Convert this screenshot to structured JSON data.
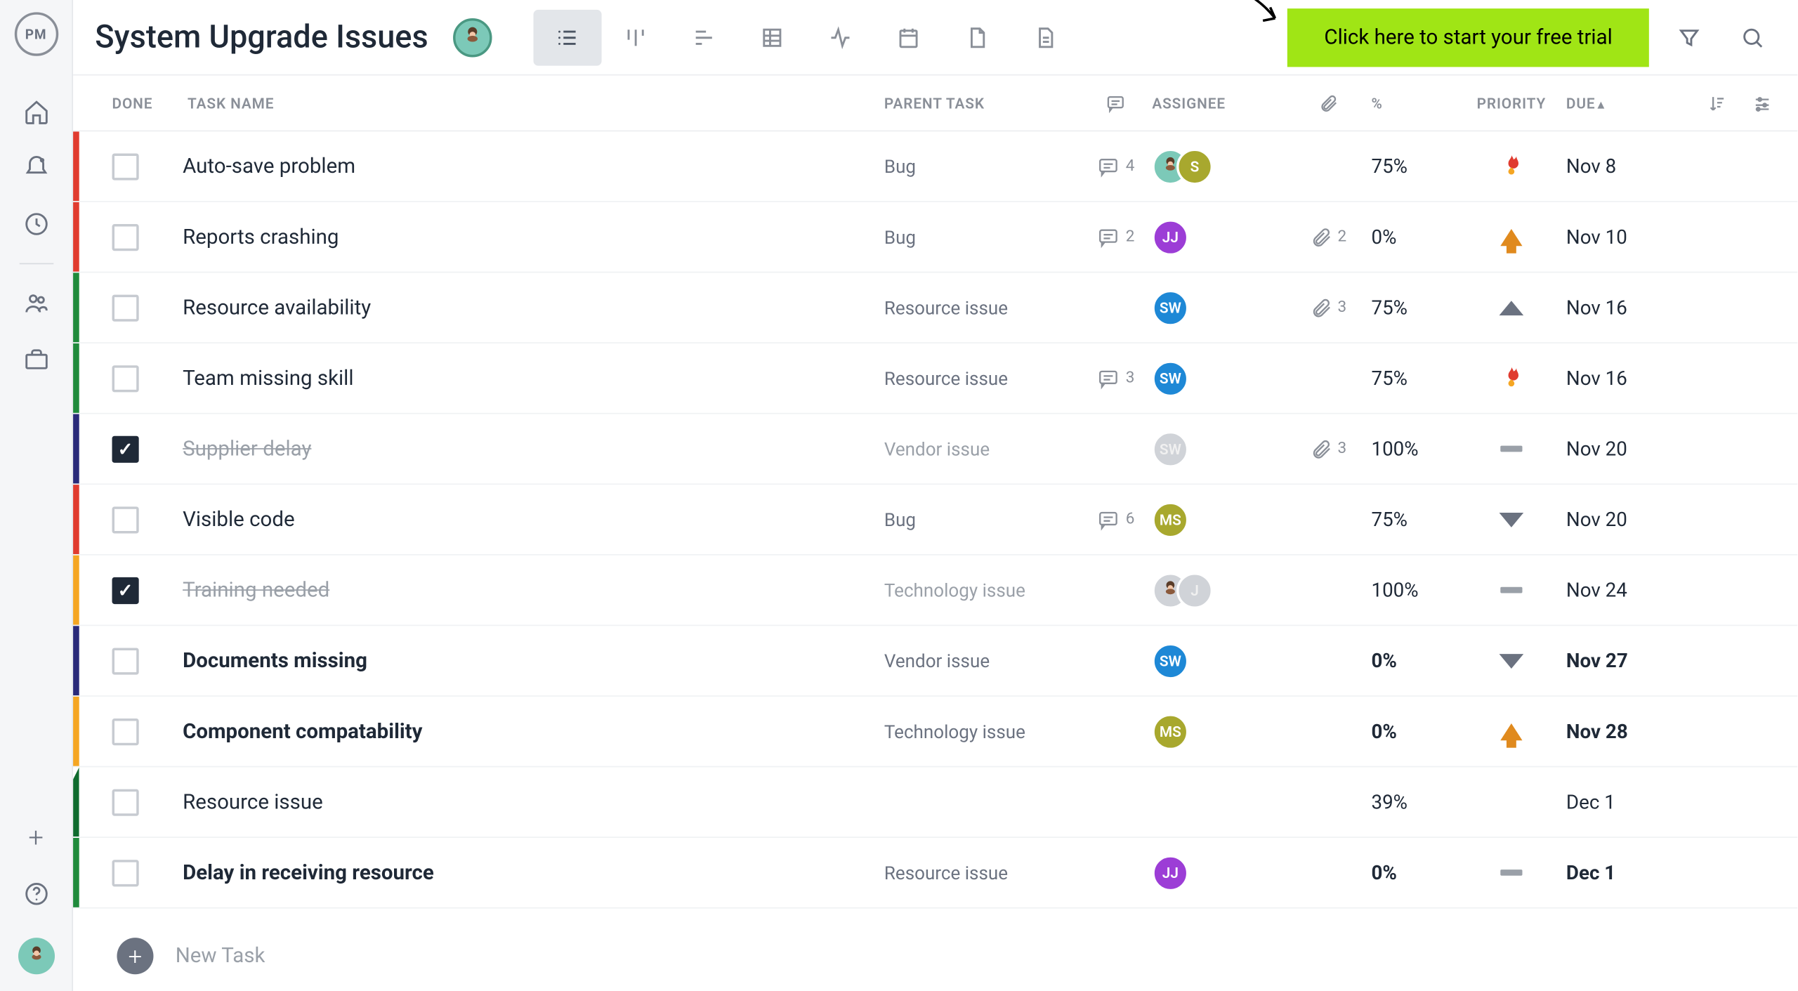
{
  "app": {
    "logo_text": "PM",
    "title": "System Upgrade Issues",
    "trial_cta": "Click here to start your free trial",
    "new_task_label": "New Task"
  },
  "columns": {
    "done": "DONE",
    "task_name": "TASK NAME",
    "parent_task": "PARENT TASK",
    "assignee": "ASSIGNEE",
    "percent": "%",
    "priority": "PRIORITY",
    "due": "DUE"
  },
  "stripe_colors": {
    "red": "#e03b2f",
    "green": "#1f8a3b",
    "navy": "#2a2a7a",
    "orange": "#f5a623",
    "dark_green": "#0f6b2e"
  },
  "tasks": [
    {
      "done": false,
      "bold": false,
      "stripe": "red",
      "name": "Auto-save problem",
      "parent": "Bug",
      "comments": 4,
      "attachments": null,
      "assignees": [
        {
          "type": "img"
        },
        {
          "type": "s",
          "label": "S"
        }
      ],
      "percent": "75%",
      "priority": "flame",
      "due": "Nov 8"
    },
    {
      "done": false,
      "bold": false,
      "stripe": "red",
      "name": "Reports crashing",
      "parent": "Bug",
      "comments": 2,
      "attachments": 2,
      "assignees": [
        {
          "type": "jj",
          "label": "JJ"
        }
      ],
      "percent": "0%",
      "priority": "up",
      "due": "Nov 10"
    },
    {
      "done": false,
      "bold": false,
      "stripe": "green",
      "name": "Resource availability",
      "parent": "Resource issue",
      "comments": null,
      "attachments": 3,
      "assignees": [
        {
          "type": "sw",
          "label": "SW"
        }
      ],
      "percent": "75%",
      "priority": "tri-up",
      "due": "Nov 16"
    },
    {
      "done": false,
      "bold": false,
      "stripe": "green",
      "name": "Team missing skill",
      "parent": "Resource issue",
      "comments": 3,
      "attachments": null,
      "assignees": [
        {
          "type": "sw",
          "label": "SW"
        }
      ],
      "percent": "75%",
      "priority": "flame",
      "due": "Nov 16"
    },
    {
      "done": true,
      "bold": false,
      "stripe": "navy",
      "name": "Supplier delay",
      "parent": "Vendor issue",
      "comments": null,
      "attachments": 3,
      "assignees": [
        {
          "type": "sw",
          "label": "SW",
          "muted": true
        }
      ],
      "percent": "100%",
      "priority": "dash",
      "due": "Nov 20"
    },
    {
      "done": false,
      "bold": false,
      "stripe": "red",
      "name": "Visible code",
      "parent": "Bug",
      "comments": 6,
      "attachments": null,
      "assignees": [
        {
          "type": "ms",
          "label": "MS"
        }
      ],
      "percent": "75%",
      "priority": "tri-dn",
      "due": "Nov 20"
    },
    {
      "done": true,
      "bold": false,
      "stripe": "orange",
      "name": "Training needed",
      "parent": "Technology issue",
      "comments": null,
      "attachments": null,
      "assignees": [
        {
          "type": "img",
          "muted": true
        },
        {
          "type": "jj",
          "label": "J",
          "muted": true
        }
      ],
      "percent": "100%",
      "priority": "dash",
      "due": "Nov 24"
    },
    {
      "done": false,
      "bold": true,
      "stripe": "navy",
      "name": "Documents missing",
      "parent": "Vendor issue",
      "comments": null,
      "attachments": null,
      "assignees": [
        {
          "type": "sw",
          "label": "SW"
        }
      ],
      "percent": "0%",
      "priority": "tri-dn",
      "due": "Nov 27"
    },
    {
      "done": false,
      "bold": true,
      "stripe": "orange",
      "name": "Component compatability",
      "parent": "Technology issue",
      "comments": null,
      "attachments": null,
      "assignees": [
        {
          "type": "ms",
          "label": "MS"
        }
      ],
      "percent": "0%",
      "priority": "up",
      "due": "Nov 28"
    },
    {
      "done": false,
      "bold": false,
      "stripe": "dark_green",
      "folded": true,
      "name": "Resource issue",
      "parent": "",
      "comments": null,
      "attachments": null,
      "assignees": [],
      "percent": "39%",
      "priority": "",
      "due": "Dec 1"
    },
    {
      "done": false,
      "bold": true,
      "stripe": "green",
      "name": "Delay in receiving resource",
      "parent": "Resource issue",
      "comments": null,
      "attachments": null,
      "assignees": [
        {
          "type": "jj",
          "label": "JJ"
        }
      ],
      "percent": "0%",
      "priority": "dash",
      "due": "Dec 1"
    }
  ]
}
